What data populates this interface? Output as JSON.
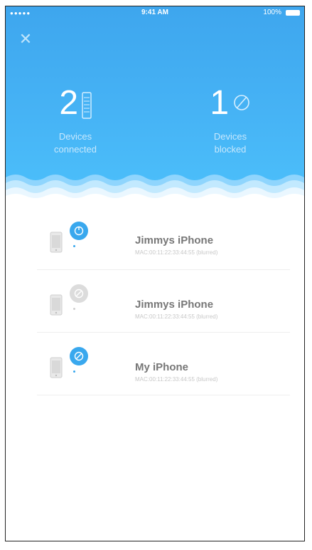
{
  "status_bar": {
    "signal": "●●●●●",
    "carrier": "",
    "time": "9:41 AM",
    "battery": "100%"
  },
  "header": {
    "close_icon": "close-icon"
  },
  "stats": {
    "connected": {
      "count": "2",
      "label_line1": "Devices",
      "label_line2": "connected"
    },
    "blocked": {
      "count": "1",
      "label_line1": "Devices",
      "label_line2": "blocked"
    }
  },
  "devices": [
    {
      "name": "Jimmys iPhone",
      "mac": "MAC:00:11:22:33:44:55 (blurred)",
      "status": "connected"
    },
    {
      "name": "Jimmys iPhone",
      "mac": "MAC:00:11:22:33:44:55 (blurred)",
      "status": "blocked"
    },
    {
      "name": "My iPhone",
      "mac": "MAC:00:11:22:33:44:55 (blurred)",
      "status": "connected"
    }
  ],
  "colors": {
    "hero_blue": "#3ea6ee",
    "connected_blue": "#39a8ee",
    "blocked_gray": "#dcdcdc"
  }
}
